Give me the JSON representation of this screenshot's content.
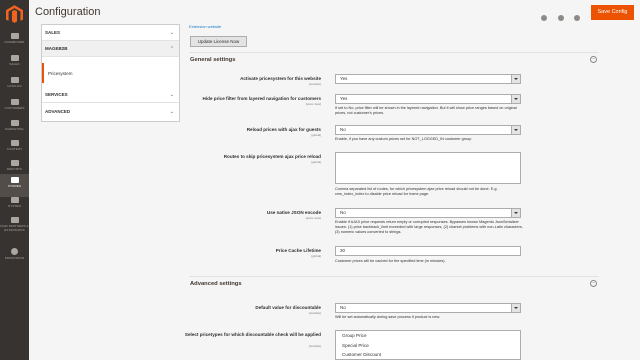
{
  "nav": {
    "items": [
      {
        "label": "Dashboard",
        "icon": "speedometer-icon"
      },
      {
        "label": "Sales",
        "icon": "dollar-icon"
      },
      {
        "label": "Catalog",
        "icon": "cube-icon"
      },
      {
        "label": "Customers",
        "icon": "user-icon"
      },
      {
        "label": "Marketing",
        "icon": "megaphone-icon"
      },
      {
        "label": "Content",
        "icon": "layout-icon"
      },
      {
        "label": "Reports",
        "icon": "bar-chart-icon"
      },
      {
        "label": "Stores",
        "icon": "store-icon"
      },
      {
        "label": "System",
        "icon": "gear-icon"
      },
      {
        "label": "Find Partners & Extensions",
        "icon": "puzzle-icon"
      },
      {
        "label": "Prisunifon",
        "icon": "circle-icon"
      }
    ],
    "active_index": 7
  },
  "header": {
    "title": "Configuration",
    "save_label": "Save Config"
  },
  "tabs": {
    "groups": [
      {
        "label": "SALES"
      },
      {
        "label": "MAGEB2B"
      },
      {
        "label": "SERVICES"
      },
      {
        "label": "ADVANCED"
      }
    ],
    "active_item": "Pricesystem"
  },
  "main": {
    "top_link": "Extension website",
    "update_license_label": "Update License Now",
    "general": {
      "title": "General settings",
      "rows": [
        {
          "label": "Activate pricesystem for this website",
          "scope": "[website]",
          "value": "Yes"
        },
        {
          "label": "Hide price filter from layered navigation for customers",
          "scope": "[store view]",
          "value": "Yes",
          "note": "If set to No, price filter will be shown in the layered navigation. But it will show price ranges based on original prices, not customer's prices."
        },
        {
          "label": "Reload prices with ajax for guests",
          "scope": "[global]",
          "value": "No",
          "note": "Enable, if you have any custom prices set for NOT_LOGGED_IN customer group"
        },
        {
          "label": "Routes to skip pricesystem ajax price reload",
          "scope": "[global]",
          "value": "",
          "note": "Comma separated list of routes, for which pricesystem ajax price reload should not be done. E.g. cms_index_index to disable price reload for home page."
        },
        {
          "label": "Use native JSON encode",
          "scope": "[store view]",
          "value": "No",
          "note": "Enable if AJAX price requests return empty or corrupted responses. Bypasses known Magento JsonSerializer issues: (1) price backtrack_limit exceeded with large responses, (2) charset problems with non-Latin characters, (3) numeric values converted to strings."
        },
        {
          "label": "Price Cache Lifetime",
          "scope": "[global]",
          "value": "30",
          "note": "Customer prices will be cached for the specified time (in minutes)."
        }
      ]
    },
    "advanced": {
      "title": "Advanced settings",
      "rows": [
        {
          "label": "Default value for discountable",
          "scope": "[website]",
          "value": "No",
          "note": "Will be set automatically during save process if product is new."
        },
        {
          "label": "Select pricetypes for which discountable check will be applied",
          "scope": "[website]",
          "options": [
            "Group Price",
            "Special Price",
            "Customer Discount"
          ]
        }
      ]
    }
  }
}
